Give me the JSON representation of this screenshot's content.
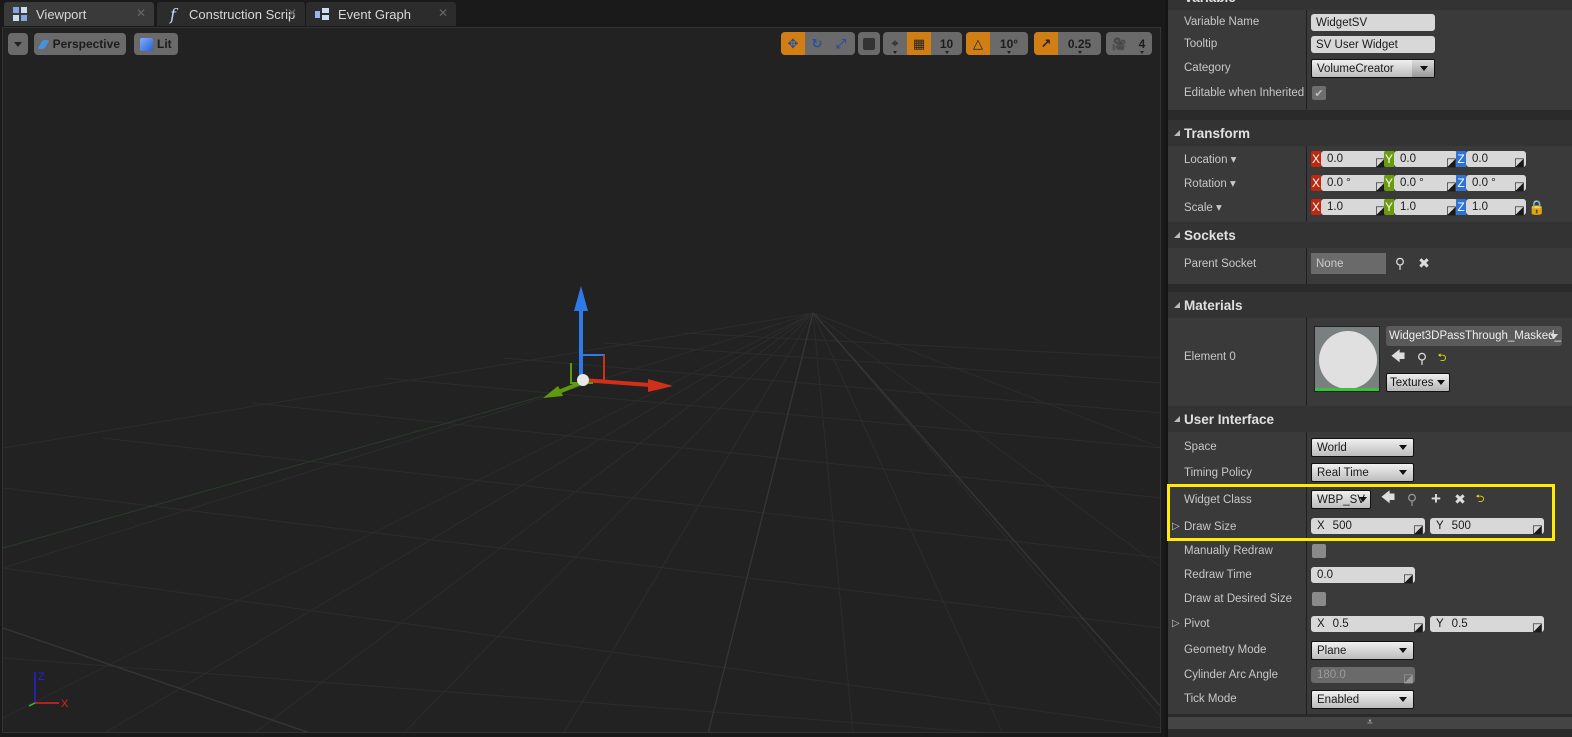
{
  "tabs": [
    {
      "label": "Viewport",
      "icon": "viewport-icon",
      "active": true
    },
    {
      "label": "Construction Scrip",
      "icon": "function-icon",
      "active": false
    },
    {
      "label": "Event Graph",
      "icon": "event-graph-icon",
      "active": false
    }
  ],
  "viewport": {
    "view_mode": "Perspective",
    "lighting_mode": "Lit",
    "grid_snap": "10",
    "rotation_snap": "10°",
    "scale_snap": "0.25",
    "camera_speed": "4",
    "axis_labels": {
      "x": "X",
      "y": "Y",
      "z": "Z"
    }
  },
  "details": {
    "variable": {
      "header": "Variable",
      "variable_name_label": "Variable Name",
      "variable_name_value": "WidgetSV",
      "tooltip_label": "Tooltip",
      "tooltip_value": "SV User Widget",
      "category_label": "Category",
      "category_value": "VolumeCreator",
      "editable_label": "Editable when Inherited",
      "editable_checked": true
    },
    "transform": {
      "header": "Transform",
      "location_label": "Location",
      "rotation_label": "Rotation",
      "scale_label": "Scale",
      "location": {
        "x": "0.0",
        "y": "0.0",
        "z": "0.0"
      },
      "rotation": {
        "x": "0.0 °",
        "y": "0.0 °",
        "z": "0.0 °"
      },
      "scale": {
        "x": "1.0",
        "y": "1.0",
        "z": "1.0"
      },
      "axis_x": "X",
      "axis_y": "Y",
      "axis_z": "Z",
      "axis_colors": {
        "x": "#c0270f",
        "y": "#6a9a0e",
        "z": "#2d72d8"
      }
    },
    "sockets": {
      "header": "Sockets",
      "parent_socket_label": "Parent Socket",
      "parent_socket_value": "None"
    },
    "materials": {
      "header": "Materials",
      "element_label": "Element 0",
      "material_value": "Widget3DPassThrough_Masked_",
      "textures_label": "Textures"
    },
    "user_interface": {
      "header": "User Interface",
      "space_label": "Space",
      "space_value": "World",
      "timing_label": "Timing Policy",
      "timing_value": "Real Time",
      "widget_class_label": "Widget Class",
      "widget_class_value": "WBP_SV",
      "draw_size_label": "Draw Size",
      "draw_size": {
        "x_label": "X",
        "x": "500",
        "y_label": "Y",
        "y": "500"
      },
      "manually_redraw_label": "Manually Redraw",
      "manually_redraw_checked": false,
      "redraw_time_label": "Redraw Time",
      "redraw_time_value": "0.0",
      "draw_desired_label": "Draw at Desired Size",
      "draw_desired_checked": false,
      "pivot_label": "Pivot",
      "pivot": {
        "x_label": "X",
        "x": "0.5",
        "y_label": "Y",
        "y": "0.5"
      },
      "geometry_label": "Geometry Mode",
      "geometry_value": "Plane",
      "cylinder_label": "Cylinder Arc Angle",
      "cylinder_value": "180.0",
      "tick_label": "Tick Mode",
      "tick_value": "Enabled"
    },
    "highlight_color": "#ffec00"
  }
}
